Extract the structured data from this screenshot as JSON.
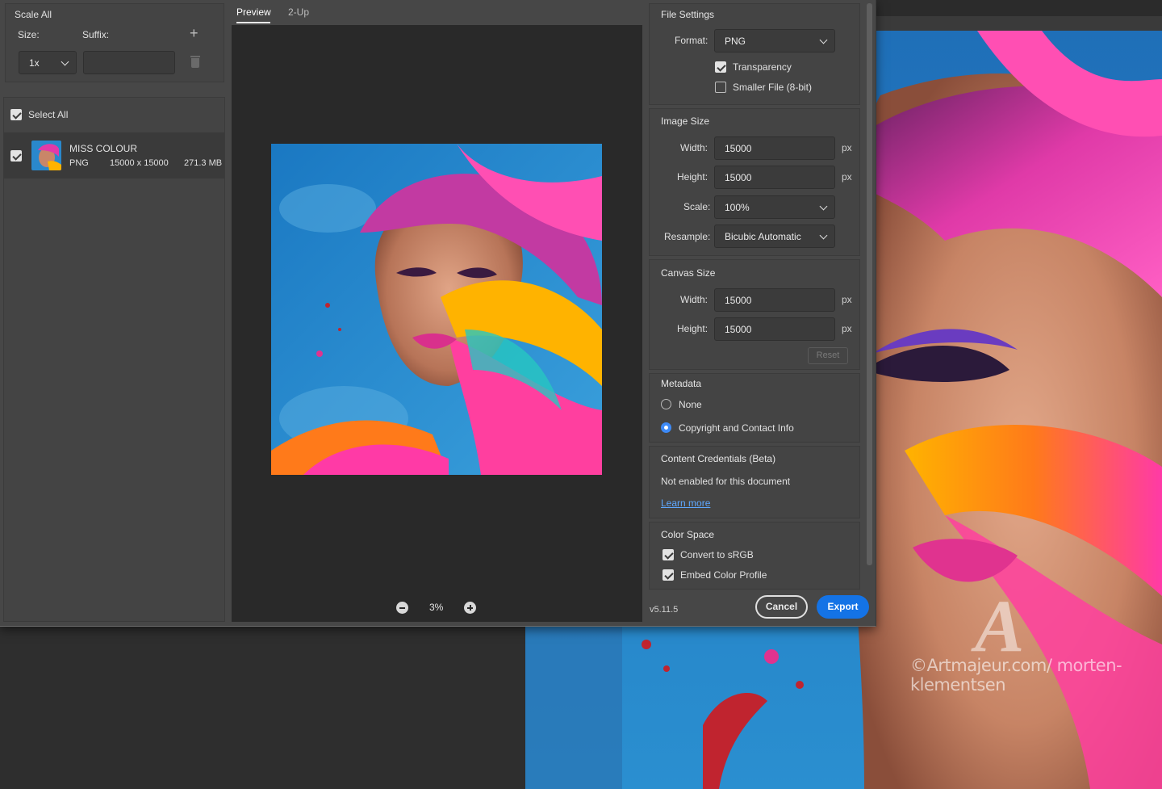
{
  "left_panel": {
    "scale_all_label": "Scale All",
    "size_label": "Size:",
    "suffix_label": "Suffix:",
    "size_value": "1x",
    "suffix_value": "",
    "select_all_label": "Select All",
    "file": {
      "name": "MISS COLOUR",
      "format": "PNG",
      "dimensions": "15000 x 15000",
      "size": "271.3 MB"
    }
  },
  "preview": {
    "tabs": [
      {
        "label": "Preview",
        "active": true
      },
      {
        "label": "2-Up",
        "active": false
      }
    ],
    "zoom": "3%"
  },
  "file_settings": {
    "title": "File Settings",
    "format_label": "Format:",
    "format_value": "PNG",
    "transparency_label": "Transparency",
    "transparency_checked": true,
    "smaller_file_label": "Smaller File (8-bit)",
    "smaller_file_checked": false
  },
  "image_size": {
    "title": "Image Size",
    "width_label": "Width:",
    "width_value": "15000",
    "height_label": "Height:",
    "height_value": "15000",
    "scale_label": "Scale:",
    "scale_value": "100%",
    "resample_label": "Resample:",
    "resample_value": "Bicubic Automatic",
    "unit": "px"
  },
  "canvas_size": {
    "title": "Canvas Size",
    "width_label": "Width:",
    "width_value": "15000",
    "height_label": "Height:",
    "height_value": "15000",
    "unit": "px",
    "reset_label": "Reset"
  },
  "metadata": {
    "title": "Metadata",
    "options": [
      {
        "label": "None",
        "selected": false
      },
      {
        "label": "Copyright and Contact Info",
        "selected": true
      }
    ]
  },
  "content_credentials": {
    "title": "Content Credentials (Beta)",
    "status": "Not enabled for this document",
    "link": "Learn more"
  },
  "color_space": {
    "title": "Color Space",
    "convert_label": "Convert to sRGB",
    "convert_checked": true,
    "embed_label": "Embed Color Profile",
    "embed_checked": true
  },
  "footer": {
    "version": "v5.11.5",
    "cancel_label": "Cancel",
    "export_label": "Export"
  },
  "canvas": {
    "watermark": "©Artmajeur.com/ morten-klementsen",
    "watermark_logo": "A"
  },
  "colors": {
    "accent": "#1473e6",
    "link": "#5ea8ff",
    "dialog_bg": "#474747",
    "preview_bg": "#292929"
  }
}
